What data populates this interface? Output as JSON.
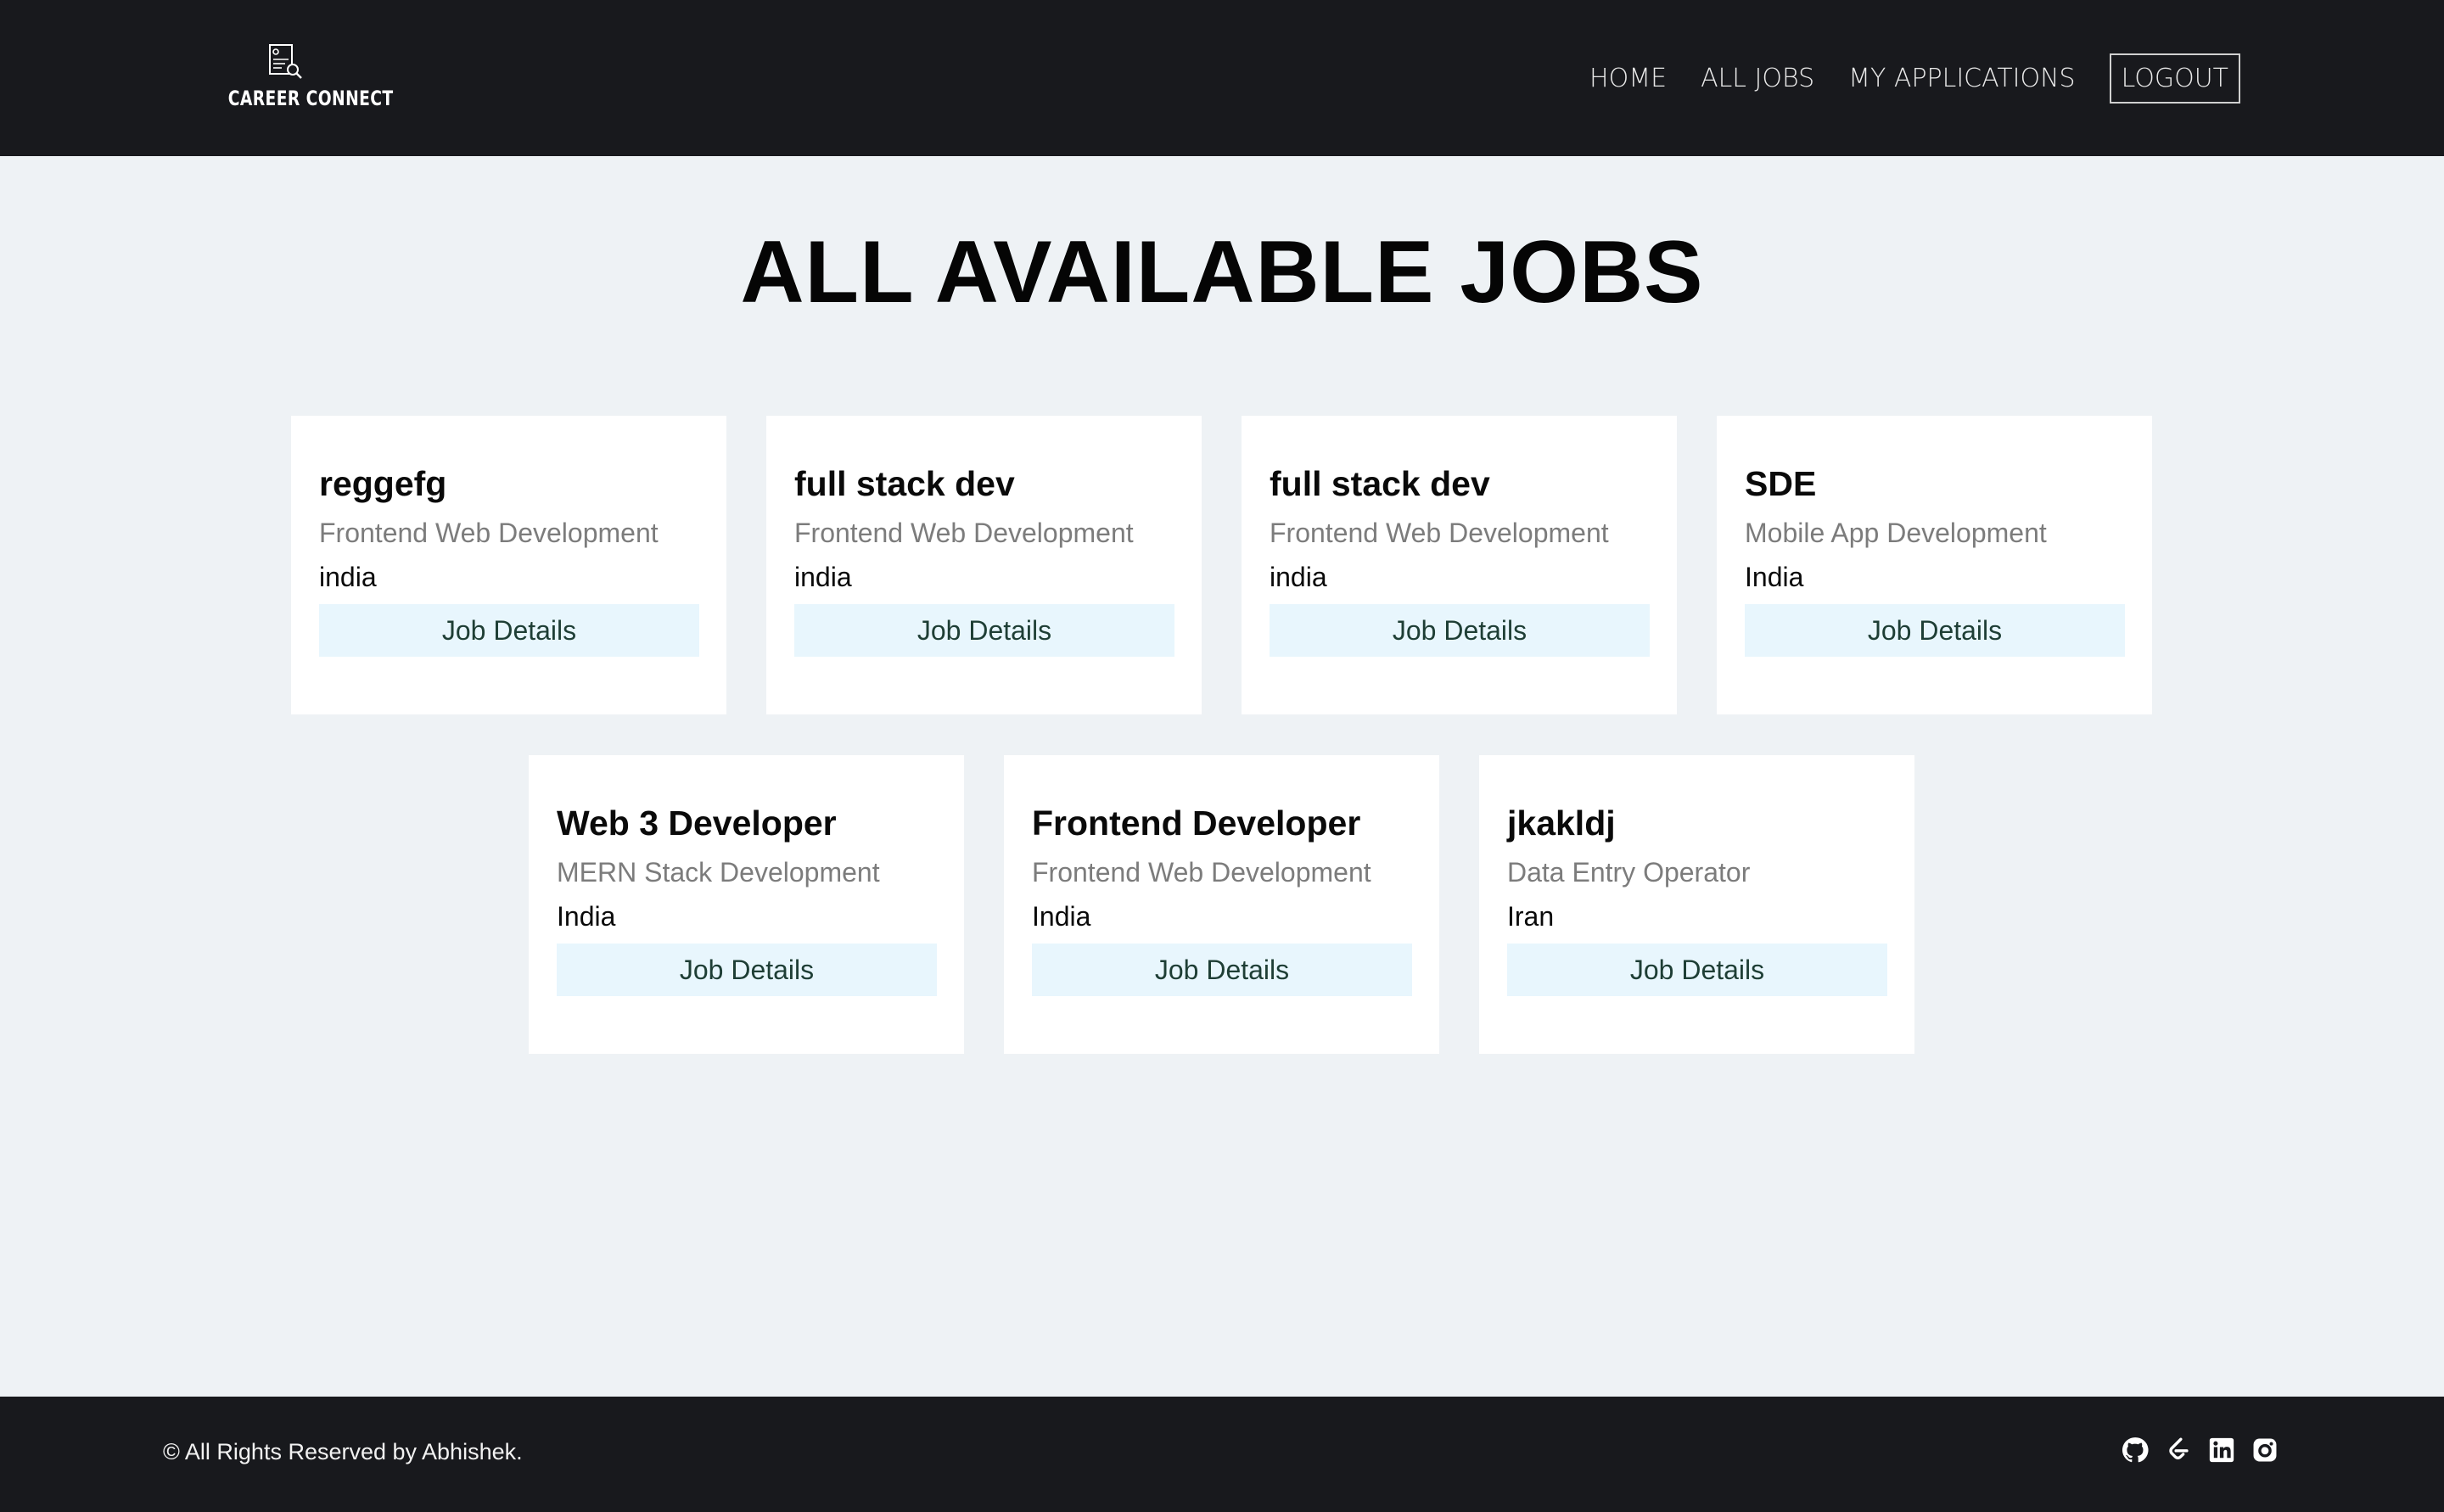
{
  "header": {
    "logo_text": "CAREER CONNECT",
    "logo_icon": "resume-search-icon",
    "nav": {
      "home": "HOME",
      "all_jobs": "ALL JOBS",
      "my_applications": "MY APPLICATIONS",
      "logout": "LOGOUT"
    }
  },
  "main": {
    "title": "ALL AVAILABLE JOBS",
    "jobs": [
      {
        "title": "reggefg",
        "category": "Frontend Web Development",
        "location": "india",
        "button": "Job Details"
      },
      {
        "title": "full stack dev",
        "category": "Frontend Web Development",
        "location": "india",
        "button": "Job Details"
      },
      {
        "title": "full stack dev",
        "category": "Frontend Web Development",
        "location": "india",
        "button": "Job Details"
      },
      {
        "title": "SDE",
        "category": "Mobile App Development",
        "location": "India",
        "button": "Job Details"
      },
      {
        "title": "Web 3 Developer",
        "category": "MERN Stack Development",
        "location": "India",
        "button": "Job Details"
      },
      {
        "title": "Frontend Developer",
        "category": "Frontend Web Development",
        "location": "India",
        "button": "Job Details"
      },
      {
        "title": "jkakldj",
        "category": "Data Entry Operator",
        "location": "Iran",
        "button": "Job Details"
      }
    ]
  },
  "footer": {
    "copyright": "© All Rights Reserved by Abhishek.",
    "social_icons": [
      "github-icon",
      "leetcode-icon",
      "linkedin-icon",
      "instagram-icon"
    ]
  },
  "colors": {
    "header_bg": "#18191d",
    "page_bg": "#eef2f5",
    "card_bg": "#ffffff",
    "button_bg": "#e8f6fd",
    "button_text": "#1e3e35",
    "category_text": "#7c7c7c"
  }
}
